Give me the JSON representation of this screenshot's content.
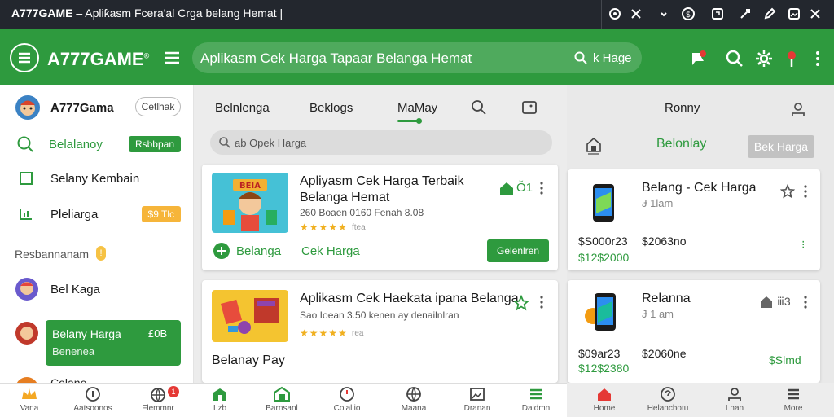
{
  "titlebar": {
    "brand": "A777GAME",
    "separator": "–",
    "title": "Apliƙasm Fcera'al Crga belang Hemat",
    "cursor": "|",
    "icons": [
      "record-icon",
      "close-icon",
      "chevron-down-icon",
      "dollar-icon",
      "box-icon",
      "gear-icon",
      "edit-icon",
      "image-icon",
      "close-icon"
    ]
  },
  "header": {
    "brand": "A777GAME",
    "brand_mark": "®",
    "search_text": "Aplikasm Cek Harga Tapaar Belanga Hemat",
    "search_button": "k Hage",
    "icons": [
      "flag-icon",
      "search-icon",
      "settings-icon",
      "location-icon",
      "more-icon"
    ],
    "accent": "#2e9a3e"
  },
  "sidebar": {
    "profile_name": "A777Gama",
    "profile_button": "Cetlhak",
    "items": [
      {
        "label": "Belalanoy",
        "chip": "Rsbbpan",
        "icon": "search-icon"
      },
      {
        "label": "Selany Kembain",
        "icon": "checkbox-icon"
      },
      {
        "label": "Pleliarga",
        "chip": "$9 Tlc",
        "icon": "list-icon"
      }
    ],
    "section_title": "Resbannanam",
    "section_badge": "!",
    "users": [
      {
        "label": "Bel Kaga"
      },
      {
        "label": "Belany Harga",
        "value": "£0B",
        "sub": "Benenea"
      },
      {
        "label": "Celane"
      }
    ]
  },
  "middle": {
    "tabs": [
      "Belnlenga",
      "Beklogs",
      "MaMay"
    ],
    "active_tab": 2,
    "search_placeholder": "ab Opek Harga",
    "cards": [
      {
        "title": "Apliyasm Cek Harga Terbaik",
        "title2": "Belanga Hemat",
        "meta": "260 Boaen 0160 Fenah 8.08",
        "stars": "★★★★★",
        "reviews": "ftea",
        "badge": "Ǒ1",
        "tag1": "Belanga",
        "tag2": "Cek Harga",
        "button": "Gelenlren",
        "image_label": "BEIA"
      },
      {
        "title": "Aplikasm Cek Haekata ipana Belanga",
        "meta": "Sao Ioean 3.50 kenen ay denailnlran",
        "stars": "★★★★★",
        "reviews": "rea",
        "footer": "Belanay Pay"
      }
    ]
  },
  "right": {
    "header": "Ronny",
    "tab_label": "Belonlay",
    "tab_button": "Bek Harga",
    "home_label": "home",
    "cards": [
      {
        "title": "Belang - Cek Harga",
        "sub": "Ɉ 1lam",
        "price1": "$S000r23",
        "price2": "$2063no",
        "price3": "$12$2000",
        "extra": "⁝"
      },
      {
        "title": "Relanna",
        "sub": "Ɉ 1 am",
        "price1": "$09ar23",
        "price2": "$2060ne",
        "price3": "$12$2380",
        "extra": "$Slmd",
        "badge": "ⅲ3"
      }
    ]
  },
  "bottom_nav": [
    {
      "label": "Vana",
      "icon": "crown-icon",
      "active": true
    },
    {
      "label": "Aatsoonos",
      "icon": "info-icon"
    },
    {
      "label": "Flemmnr",
      "icon": "globe-icon",
      "badge": "1"
    },
    {
      "label": "Lzb",
      "icon": "chart-icon"
    },
    {
      "label": "Barnsanl",
      "icon": "store-icon"
    },
    {
      "label": "Colallio",
      "icon": "clock-icon"
    },
    {
      "label": "Maana",
      "icon": "globe-icon"
    },
    {
      "label": "Dranan",
      "icon": "image-icon"
    },
    {
      "label": "Daidmn",
      "icon": "menu-icon"
    },
    {
      "label": "Home",
      "icon": "home-icon"
    },
    {
      "label": "Helanchotu",
      "icon": "help-icon"
    },
    {
      "label": "Lnan",
      "icon": "profile-icon"
    },
    {
      "label": "More",
      "icon": "menu-icon"
    }
  ]
}
